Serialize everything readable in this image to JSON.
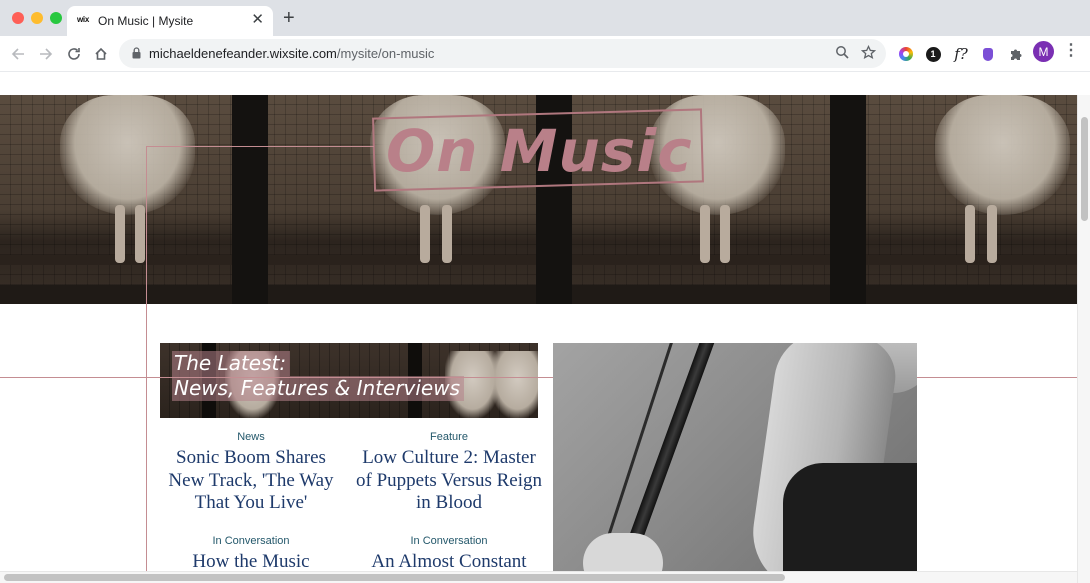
{
  "browser": {
    "tab": {
      "favicon_text": "wix",
      "title": "On Music | Mysite",
      "close_glyph": "✕"
    },
    "new_tab_glyph": "+",
    "address": {
      "domain": "michaeldenefeander.wixsite.com",
      "path": "/mysite/on-music"
    },
    "extensions": {
      "one_label": "1",
      "fn_label": "f?"
    },
    "profile_initial": "M",
    "icons": [
      "back-arrow-icon",
      "forward-arrow-icon",
      "reload-icon",
      "home-icon",
      "lock-icon",
      "zoom-icon",
      "star-icon",
      "color-wheel-extension-icon",
      "onepassword-extension-icon",
      "function-extension-icon",
      "purple-extension-icon",
      "puzzle-icon",
      "more-vertical-icon"
    ]
  },
  "page": {
    "hero_title": "On Music",
    "latest": {
      "line1": "The Latest:",
      "line2": "News, Features & Interviews"
    },
    "articles": [
      {
        "category": "News",
        "title": "Sonic Boom Shares New Track, 'The Way That You Live'"
      },
      {
        "category": "Feature",
        "title": "Low Culture 2: Master of Puppets Versus Reign in Blood"
      },
      {
        "category": "In Conversation",
        "title": "How the Music"
      },
      {
        "category": "In Conversation",
        "title": "An Almost Constant"
      }
    ],
    "colors": {
      "accent_pink": "#b98089",
      "heading_blue": "#1e3a6b",
      "category_teal": "#24586b"
    }
  }
}
